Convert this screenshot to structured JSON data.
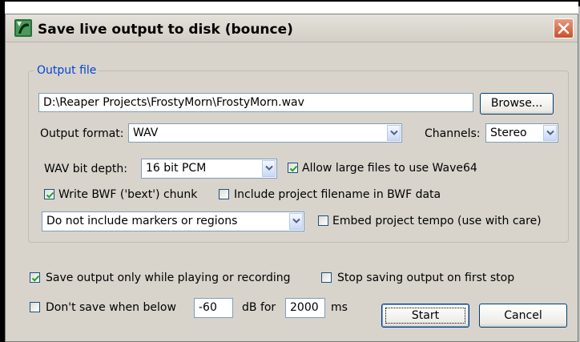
{
  "window": {
    "title": "Save live output to disk (bounce)",
    "close_glyph": "✕"
  },
  "output_file": {
    "group_label": "Output file",
    "path": "D:\\Reaper Projects\\FrostyMorn\\FrostyMorn.wav",
    "browse_label": "Browse...",
    "format_label": "Output format:",
    "format_value": "WAV",
    "channels_label": "Channels:",
    "channels_value": "Stereo",
    "bitdepth_label": "WAV bit depth:",
    "bitdepth_value": "16 bit PCM",
    "wave64_label": "Allow large files to use Wave64",
    "wave64_checked": true,
    "bwf_label": "Write BWF ('bext') chunk",
    "bwf_checked": true,
    "include_filename_label": "Include project filename in BWF data",
    "include_filename_checked": false,
    "markers_value": "Do not include markers or regions",
    "embed_tempo_label": "Embed project tempo (use with care)",
    "embed_tempo_checked": false
  },
  "options": {
    "save_while_playing_label": "Save output only while playing or recording",
    "save_while_playing_checked": true,
    "stop_first_label": "Stop saving output on first stop",
    "stop_first_checked": false,
    "dont_save_label": "Don't save when below",
    "dont_save_checked": false,
    "db_value": "-60",
    "db_for_label": "dB for",
    "ms_value": "2000",
    "ms_label": "ms"
  },
  "buttons": {
    "start": "Start",
    "cancel": "Cancel"
  },
  "colors": {
    "titlebar": "#d4d0c8",
    "accent": "#0046d5",
    "close": "#d66a4c",
    "check": "#21a121"
  }
}
